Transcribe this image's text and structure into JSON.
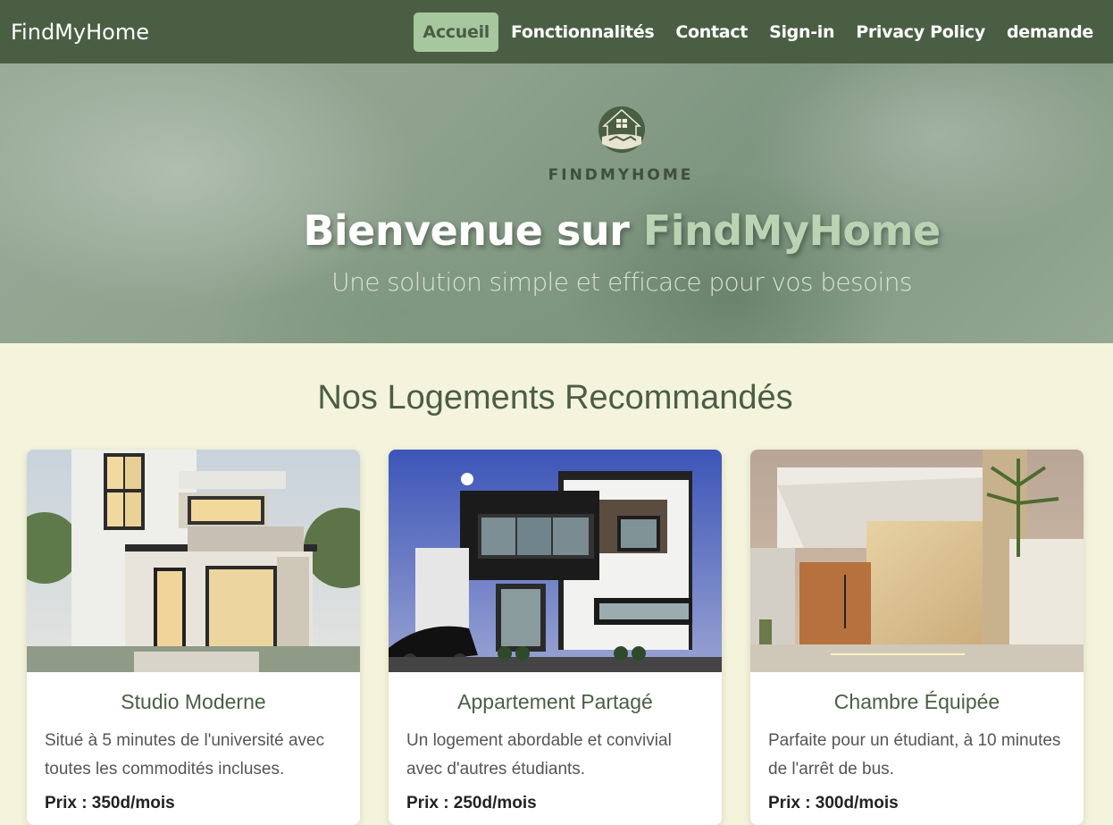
{
  "navbar": {
    "brand": "FindMyHome",
    "links": [
      "Accueil",
      "Fonctionnalités",
      "Contact",
      "Sign-in",
      "Privacy Policy",
      "demande"
    ],
    "active_index": 0
  },
  "hero": {
    "logo_wordmark": "FINDMYHOME",
    "title_prefix": "Bienvenue sur",
    "title_highlight": "FindMyHome",
    "subtitle": "Une solution simple et efficace pour vos besoins"
  },
  "section": {
    "title": "Nos Logements Recommandés"
  },
  "listings": [
    {
      "title": "Studio Moderne",
      "description": "Situé à 5 minutes de l'université avec toutes les commodités incluses.",
      "price": "Prix : 350d/mois"
    },
    {
      "title": "Appartement Partagé",
      "description": "Un logement abordable et convivial avec d'autres étudiants.",
      "price": "Prix : 250d/mois"
    },
    {
      "title": "Chambre Équipée",
      "description": "Parfaite pour un étudiant, à 10 minutes de l'arrêt de bus.",
      "price": "Prix : 300d/mois"
    }
  ],
  "colors": {
    "navbar_bg": "#4a5e44",
    "active_link_bg": "#a7c79f",
    "page_bg": "#f4f3dc",
    "accent_text": "#bcd3b3"
  }
}
